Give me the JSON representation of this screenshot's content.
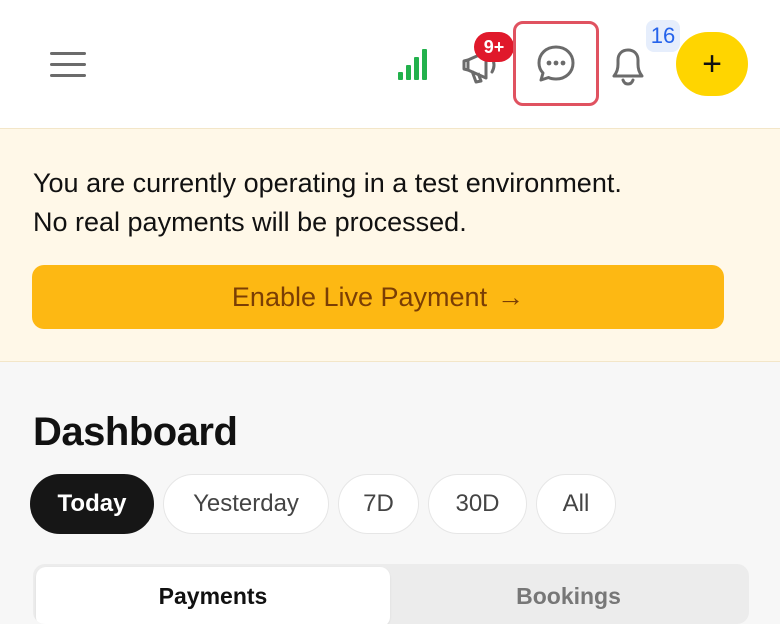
{
  "header": {
    "menu_icon": "hamburger-menu-icon",
    "signal_icon": "signal-bars-icon",
    "announce_icon": "megaphone-icon",
    "announce_badge": "9+",
    "chat_icon": "chat-bubble-icon",
    "bell_icon": "bell-icon",
    "bell_badge": "16",
    "add_label": "+"
  },
  "banner": {
    "line1": "You are currently operating in a test environment.",
    "line2": "No real payments will be processed.",
    "button_label": "Enable Live Payment",
    "button_arrow": "→"
  },
  "dashboard": {
    "title": "Dashboard",
    "filters": [
      {
        "label": "Today",
        "active": true
      },
      {
        "label": "Yesterday",
        "active": false
      },
      {
        "label": "7D",
        "active": false
      },
      {
        "label": "30D",
        "active": false
      },
      {
        "label": "All",
        "active": false
      }
    ],
    "tabs": [
      {
        "label": "Payments",
        "active": true
      },
      {
        "label": "Bookings",
        "active": false
      }
    ]
  },
  "colors": {
    "accent_yellow": "#ffd500",
    "banner_bg": "#fff8e8",
    "live_button": "#fdb813",
    "badge_red": "#e0192b",
    "signal_green": "#22b14c",
    "highlight_red": "#e05260"
  }
}
